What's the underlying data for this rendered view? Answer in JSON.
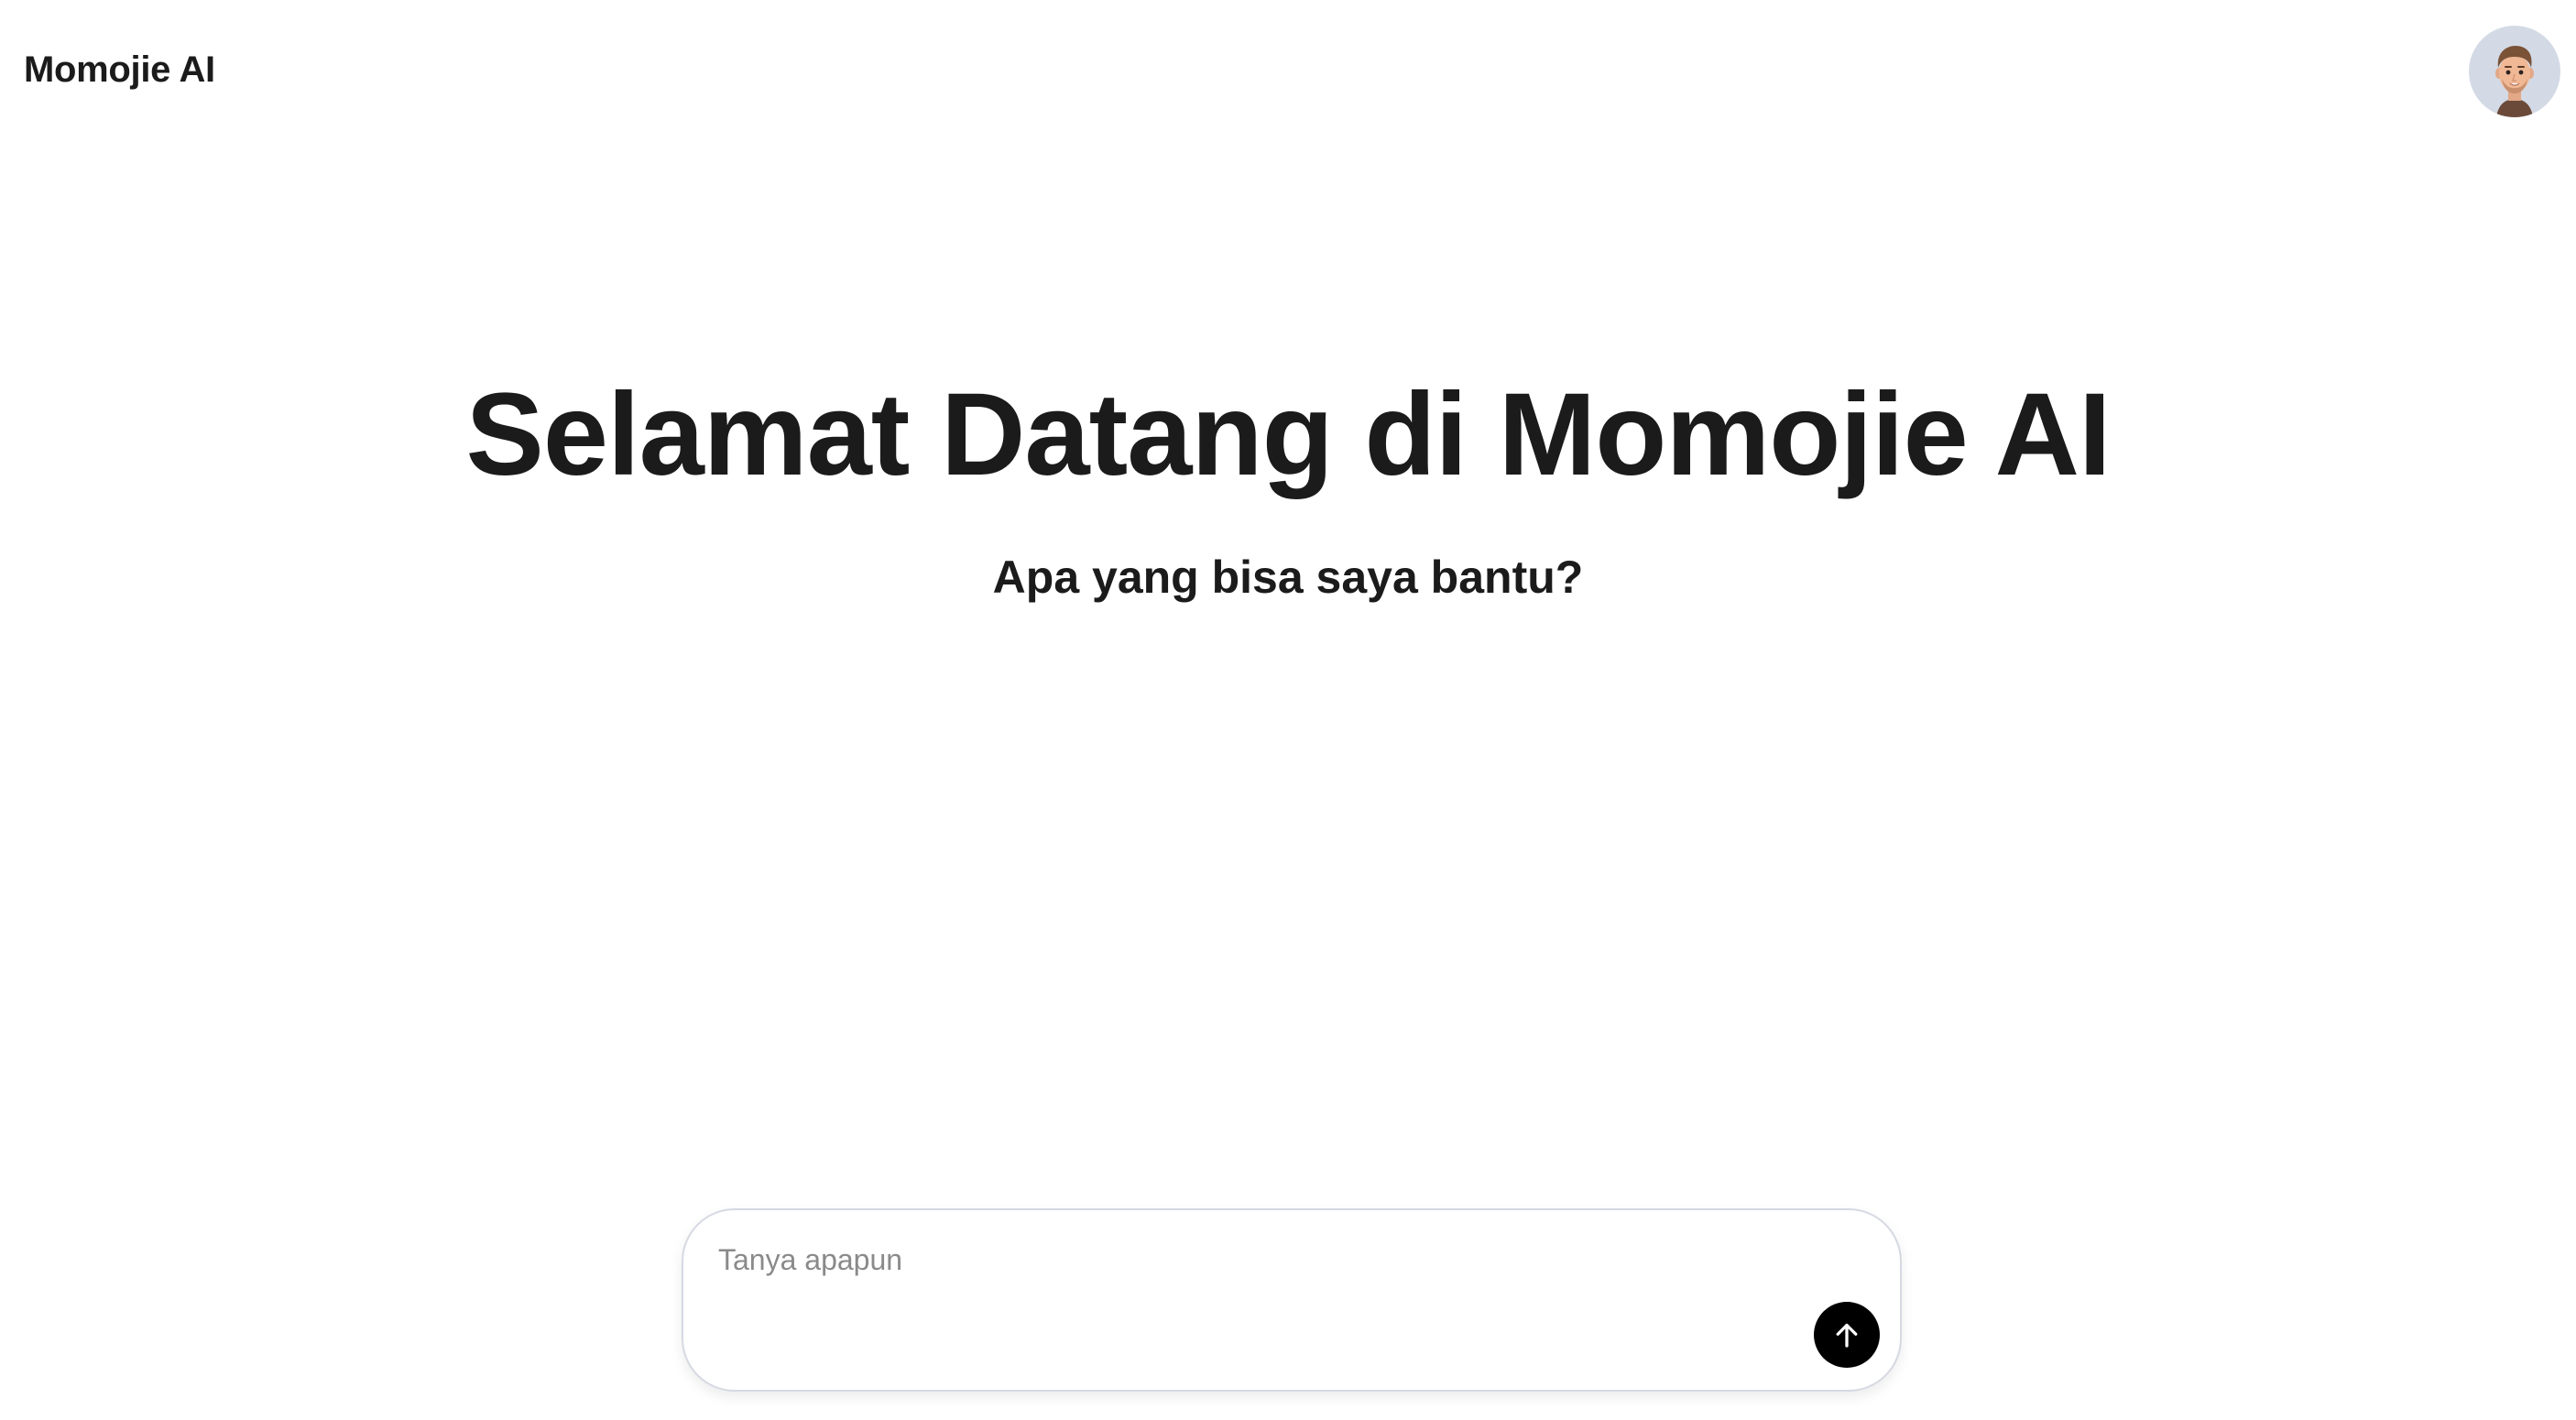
{
  "header": {
    "brand": "Momojie AI",
    "avatar_icon": "memoji-avatar-icon"
  },
  "hero": {
    "title": "Selamat Datang di Momojie AI",
    "subtitle": "Apa yang bisa saya bantu?"
  },
  "composer": {
    "placeholder": "Tanya apapun",
    "value": "",
    "send_icon": "arrow-up-icon"
  },
  "colors": {
    "text": "#1b1b1b",
    "avatar_background": "#d3dae5",
    "send_button": "#000000",
    "composer_border": "#d6d9e2",
    "placeholder": "#8a8a8a"
  }
}
